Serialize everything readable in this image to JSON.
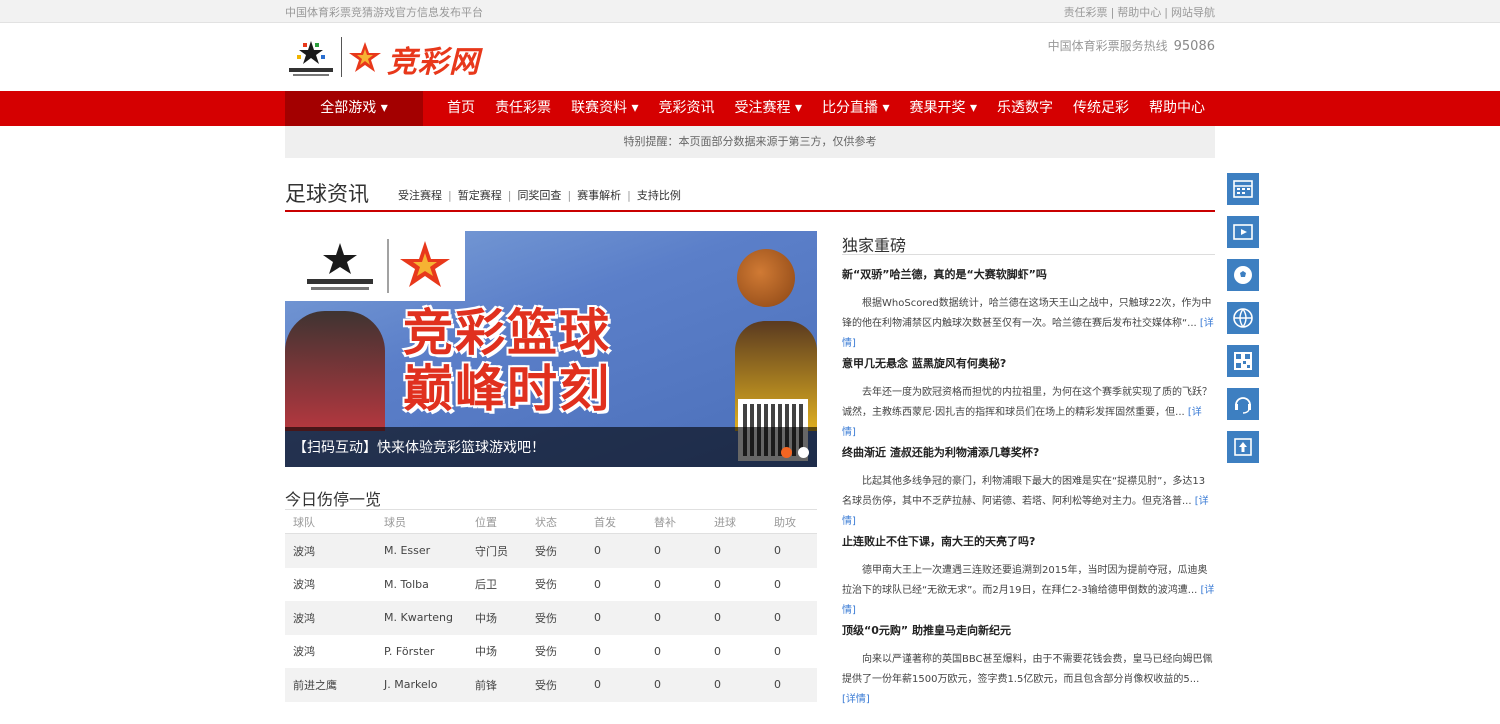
{
  "topbar": {
    "left_text": "中国体育彩票竞猜游戏官方信息发布平台",
    "links": [
      "责任彩票",
      "帮助中心",
      "网站导航"
    ],
    "separator": "|"
  },
  "header": {
    "logo_brand": "竞彩网",
    "hotline_label": "中国体育彩票服务热线",
    "hotline_number": "95086"
  },
  "nav": {
    "all_games": "全部游戏 ▾",
    "items": [
      "首页",
      "责任彩票",
      "联赛资料 ▾",
      "竞彩资讯",
      "受注赛程 ▾",
      "比分直播 ▾",
      "赛果开奖 ▾",
      "乐透数字",
      "传统足彩",
      "帮助中心"
    ]
  },
  "notice": "特别提醒：本页面部分数据来源于第三方，仅供参考",
  "section": {
    "title": "足球资讯",
    "links": [
      "受注赛程",
      "暂定赛程",
      "同奖回查",
      "赛事解析",
      "支持比例"
    ],
    "separator": "|"
  },
  "banner": {
    "headline_line1": "竞彩篮球",
    "headline_line2": "巅峰时刻",
    "caption": "【扫码互动】快来体验竞彩篮球游戏吧！"
  },
  "injury": {
    "title": "今日伤停一览",
    "columns": [
      "球队",
      "球员",
      "位置",
      "状态",
      "首发",
      "替补",
      "进球",
      "助攻"
    ],
    "rows": [
      [
        "波鸿",
        "M. Esser",
        "守门员",
        "受伤",
        "0",
        "0",
        "0",
        "0"
      ],
      [
        "波鸿",
        "M. Tolba",
        "后卫",
        "受伤",
        "0",
        "0",
        "0",
        "0"
      ],
      [
        "波鸿",
        "M. Kwarteng",
        "中场",
        "受伤",
        "0",
        "0",
        "0",
        "0"
      ],
      [
        "波鸿",
        "P. Förster",
        "中场",
        "受伤",
        "0",
        "0",
        "0",
        "0"
      ],
      [
        "前进之鹰",
        "J. Markelo",
        "前锋",
        "受伤",
        "0",
        "0",
        "0",
        "0"
      ]
    ]
  },
  "exclusive": {
    "title": "独家重磅",
    "more_label": "[详情]",
    "items": [
      {
        "title": "新“双骄”哈兰德，真的是“大赛软脚虾”吗",
        "desc": "根据WhoScored数据统计，哈兰德在这场天王山之战中，只触球22次，作为中锋的他在利物浦禁区内触球次数甚至仅有一次。哈兰德在赛后发布社交媒体称“..."
      },
      {
        "title": "意甲几无悬念 蓝黑旋风有何奥秘?",
        "desc": "去年还一度为欧冠资格而担忧的内拉祖里，为何在这个赛季就实现了质的飞跃？诚然，主教练西蒙尼·因扎吉的指挥和球员们在场上的精彩发挥固然重要，但..."
      },
      {
        "title": "终曲渐近 渣叔还能为利物浦添几尊奖杯?",
        "desc": "比起其他多线争冠的豪门，利物浦眼下最大的困难是实在“捉襟见肘”，多达13名球员伤停，其中不乏萨拉赫、阿诺德、若塔、阿利松等绝对主力。但克洛普..."
      },
      {
        "title": "止连败止不住下课，南大王的天亮了吗?",
        "desc": "德甲南大王上一次遭遇三连败还要追溯到2015年，当时因为提前夺冠，瓜迪奥拉治下的球队已经“无欲无求”。而2月19日，在拜仁2-3输给德甲倒数的波鸿遭..."
      },
      {
        "title": "顶级“0元购” 助推皇马走向新纪元",
        "desc": "向来以严谨著称的英国BBC甚至爆料，由于不需要花钱会费，皇马已经向姆巴佩提供了一份年薪1500万欧元，签字费1.5亿欧元，而且包含部分肖像权收益的5..."
      }
    ]
  },
  "sidebar": {
    "icons": [
      "schedule-icon",
      "video-icon",
      "football-icon",
      "basketball-icon",
      "qrcode-icon",
      "customer-service-icon",
      "back-to-top-icon"
    ]
  },
  "colors": {
    "brand_red": "#d50001",
    "dark_red": "#a30000",
    "sidebar_blue": "#3d7fc1",
    "link_blue": "#3a7bd5"
  }
}
